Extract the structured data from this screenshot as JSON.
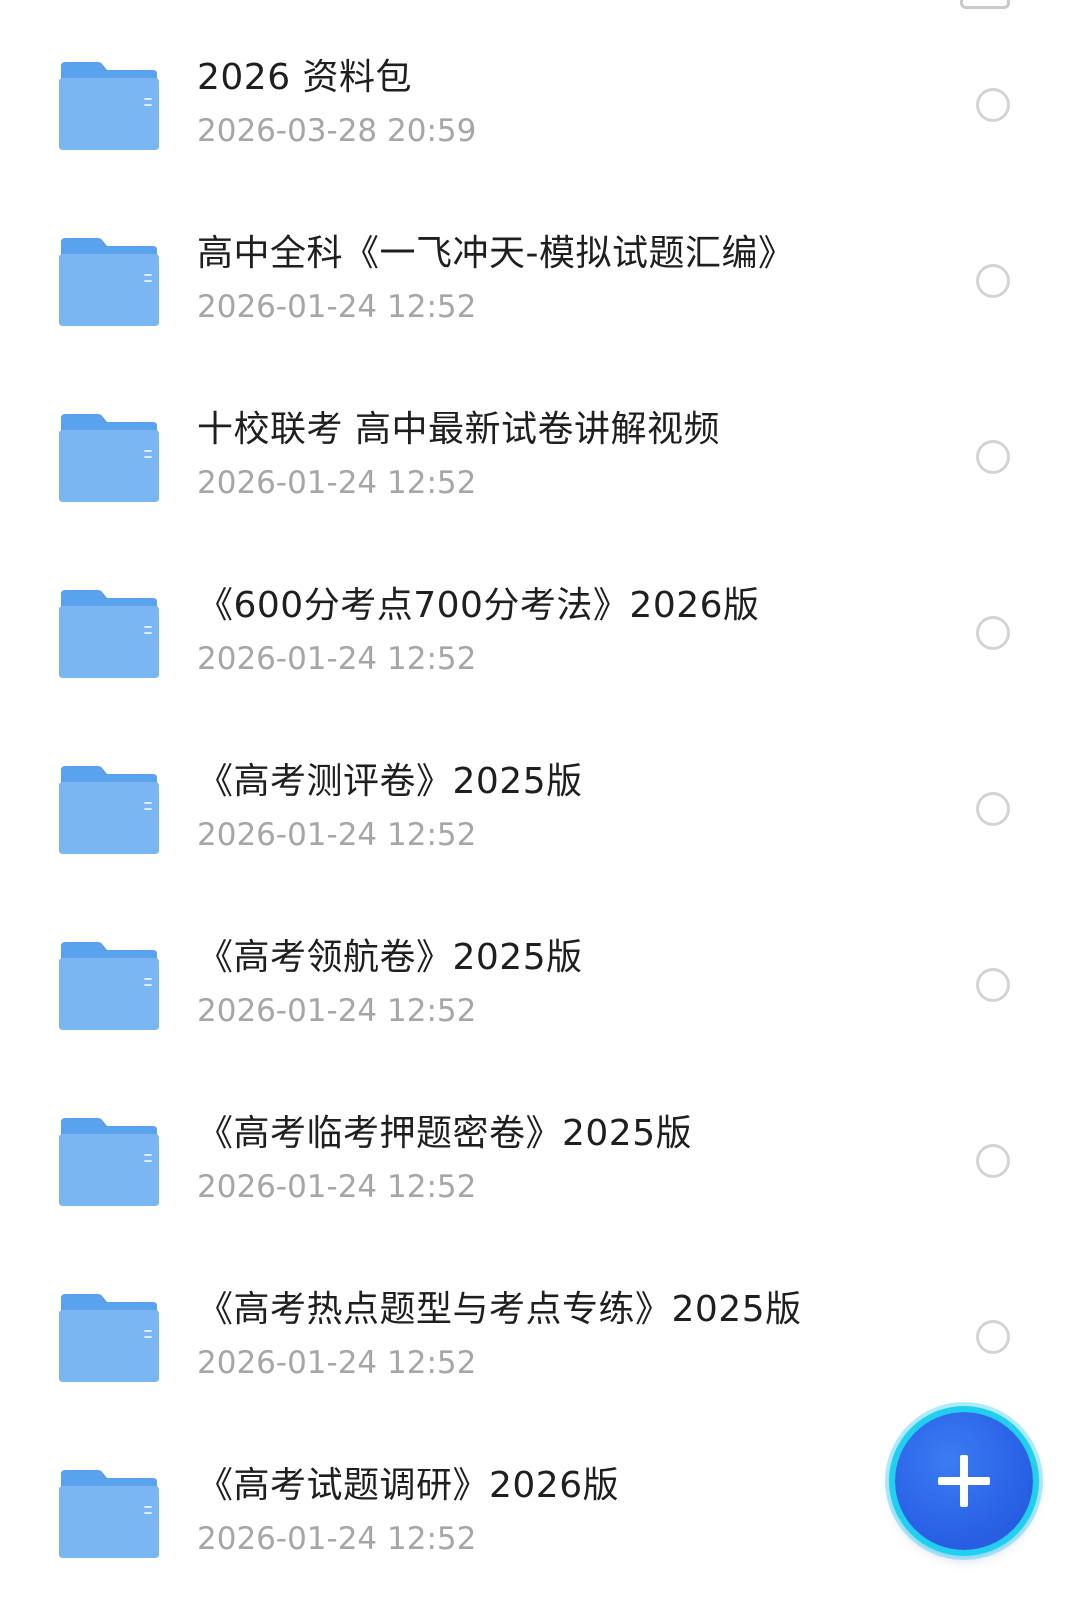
{
  "colors": {
    "folder_front": "#7ab6f2",
    "folder_back": "#5aa2ee",
    "name_text": "#1f1f1f",
    "date_text": "#a6a6a6",
    "fab": "#2a62e6",
    "fab_ring": "#1fd0f0"
  },
  "icons": {
    "folder": "folder-icon",
    "select": "radio-unchecked-icon",
    "add": "plus-icon"
  },
  "files": [
    {
      "name": "2026 资料包",
      "date": "2026-03-28 20:59"
    },
    {
      "name": "高中全科《一飞冲天-模拟试题汇编》",
      "date": "2026-01-24 12:52"
    },
    {
      "name": "十校联考 高中最新试卷讲解视频",
      "date": "2026-01-24 12:52"
    },
    {
      "name": "《600分考点700分考法》2026版",
      "date": "2026-01-24 12:52"
    },
    {
      "name": "《高考测评卷》2025版",
      "date": "2026-01-24 12:52"
    },
    {
      "name": "《高考领航卷》2025版",
      "date": "2026-01-24 12:52"
    },
    {
      "name": "《高考临考押题密卷》2025版",
      "date": "2026-01-24 12:52"
    },
    {
      "name": "《高考热点题型与考点专练》2025版",
      "date": "2026-01-24 12:52"
    },
    {
      "name": "《高考试题调研》2026版",
      "date": "2026-01-24 12:52"
    }
  ]
}
